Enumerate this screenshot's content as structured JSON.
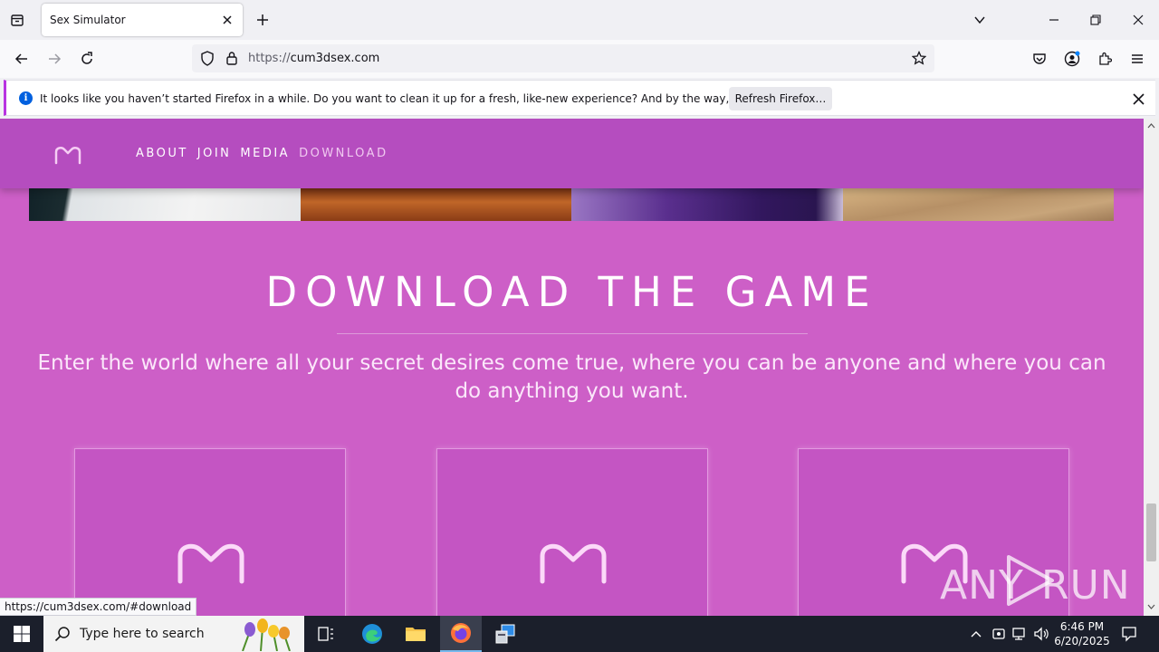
{
  "browser": {
    "tab_title": "Sex Simulator",
    "url_prefix": "https://",
    "url_domain": "cum3dsex.com",
    "notification": {
      "message": "It looks like you haven’t started Firefox in a while. Do you want to clean it up for a fresh, like-new experience? And by the way, welcome back!",
      "button_label": "Refresh Firefox…"
    },
    "status_link": "https://cum3dsex.com/#download"
  },
  "site": {
    "nav": [
      "ABOUT",
      "JOIN",
      "MEDIA",
      "DOWNLOAD"
    ],
    "hero_title": "DOWNLOAD THE GAME",
    "hero_subtitle": "Enter the world where all your secret desires come true, where you can be anyone and where you can do anything you want.",
    "cards": 3,
    "colors": {
      "page_bg": "#cd5fc7",
      "header_bg": "#b54dbf",
      "accent": "#b833e1"
    }
  },
  "watermark": {
    "left": "ANY",
    "right": "RUN"
  },
  "taskbar": {
    "search_placeholder": "Type here to search",
    "time": "6:46 PM",
    "date": "6/20/2025"
  },
  "icons": [
    "tab-list-icon",
    "close-icon",
    "plus-icon",
    "chevron-down-icon",
    "minimize-icon",
    "restore-icon",
    "back-icon",
    "forward-icon",
    "reload-icon",
    "shield-icon",
    "lock-icon",
    "star-icon",
    "pocket-icon",
    "account-icon",
    "extensions-icon",
    "menu-icon",
    "info-icon",
    "windows-icon",
    "search-icon",
    "task-view-icon",
    "edge-icon",
    "folder-icon",
    "firefox-icon",
    "app-icon",
    "chevron-up-icon",
    "network-icon",
    "volume-icon",
    "notification-icon"
  ]
}
